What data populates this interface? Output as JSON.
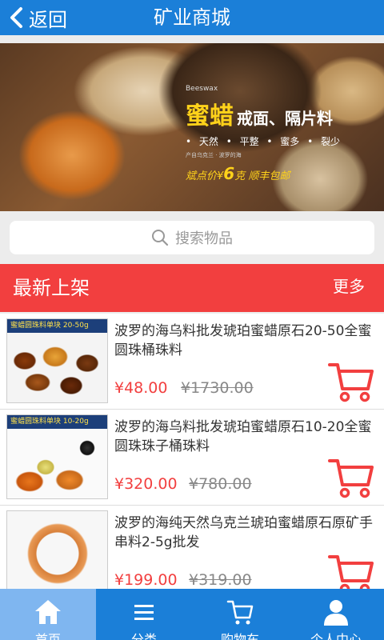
{
  "header": {
    "back_label": "返回",
    "title": "矿业商城"
  },
  "banner": {
    "en_text": "Beeswax",
    "headline_big": "蜜蜡",
    "headline_sub": "戒面、隔片料",
    "features": "• 天然 • 平整 • 蜜多 • 裂少",
    "small_text": "产自乌克兰 · 波罗的海",
    "promo_prefix": "斌点价¥",
    "promo_num": "6",
    "promo_suffix": "克 顺丰包邮",
    "dots": 3,
    "active_dot": 0
  },
  "search": {
    "placeholder": "搜索物品"
  },
  "section": {
    "title": "最新上架",
    "more": "更多"
  },
  "products": [
    {
      "thumb_label": "蜜蜡圆珠料单块 20-50g",
      "name": "波罗的海乌料批发琥珀蜜蜡原石20-50全蜜圆珠桶珠料",
      "price": "¥48.00",
      "old_price": "¥1730.00"
    },
    {
      "thumb_label": "蜜蜡圆珠料单块 10-20g",
      "name": "波罗的海乌料批发琥珀蜜蜡原石10-20全蜜圆珠珠子桶珠料",
      "price": "¥320.00",
      "old_price": "¥780.00"
    },
    {
      "thumb_label": "",
      "name": "波罗的海纯天然乌克兰琥珀蜜蜡原石原矿手串料2-5g批发",
      "price": "¥199.00",
      "old_price": "¥319.00"
    }
  ],
  "tabs": [
    {
      "label": "首页",
      "icon": "home-icon",
      "active": true
    },
    {
      "label": "分类",
      "icon": "menu-icon",
      "active": false
    },
    {
      "label": "购物车",
      "icon": "cart-icon",
      "active": false
    },
    {
      "label": "个人中心",
      "icon": "user-icon",
      "active": false
    }
  ],
  "colors": {
    "primary": "#1b7fd8",
    "accent": "#f23f3f",
    "tab_active": "#7fb6f0"
  }
}
